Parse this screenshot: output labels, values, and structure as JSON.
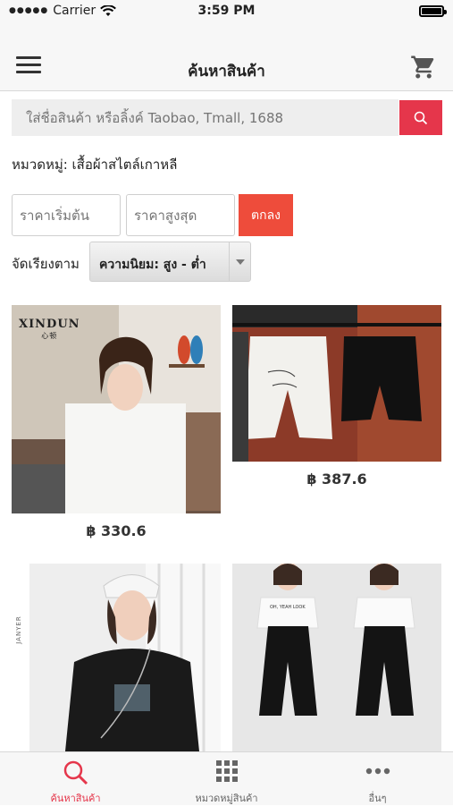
{
  "status_bar": {
    "carrier": "Carrier",
    "time": "3:59 PM"
  },
  "nav": {
    "title": "ค้นหาสินค้า",
    "menu_icon": "hamburger-menu-icon",
    "cart_icon": "shopping-cart-icon"
  },
  "search": {
    "placeholder": "ใส่ชื่อสินค้า หรือลิ้งค์ Taobao, Tmall, 1688",
    "button_icon": "search-icon"
  },
  "category": {
    "text": "หมวดหมู่: เสื้อผ้าสไตล์เกาหลี"
  },
  "price_filter": {
    "min_placeholder": "ราคาเริ่มต้น",
    "max_placeholder": "ราคาสูงสุด",
    "ok_label": "ตกลง"
  },
  "sort": {
    "label": "จัดเรียงตาม",
    "selected": "ความนิยม: สูง - ต่ำ"
  },
  "products": [
    {
      "price": "฿ 330.6",
      "brand": "XINDUN",
      "brand_sub": "心顿"
    },
    {
      "price": "฿ 387.6"
    },
    {
      "side_text": "JANYER"
    },
    {
      "shirt_text": "OH, YEAH LOOK"
    }
  ],
  "tabs": [
    {
      "label": "ค้นหาสินค้า",
      "icon": "search-icon",
      "active": true
    },
    {
      "label": "หมวดหมู่สินค้า",
      "icon": "grid-icon",
      "active": false
    },
    {
      "label": "อื่นๆ",
      "icon": "more-icon",
      "active": false
    }
  ],
  "colors": {
    "accent": "#e5364b",
    "ok_button": "#ee4c3b",
    "nav_bg": "#f7f7f7"
  }
}
